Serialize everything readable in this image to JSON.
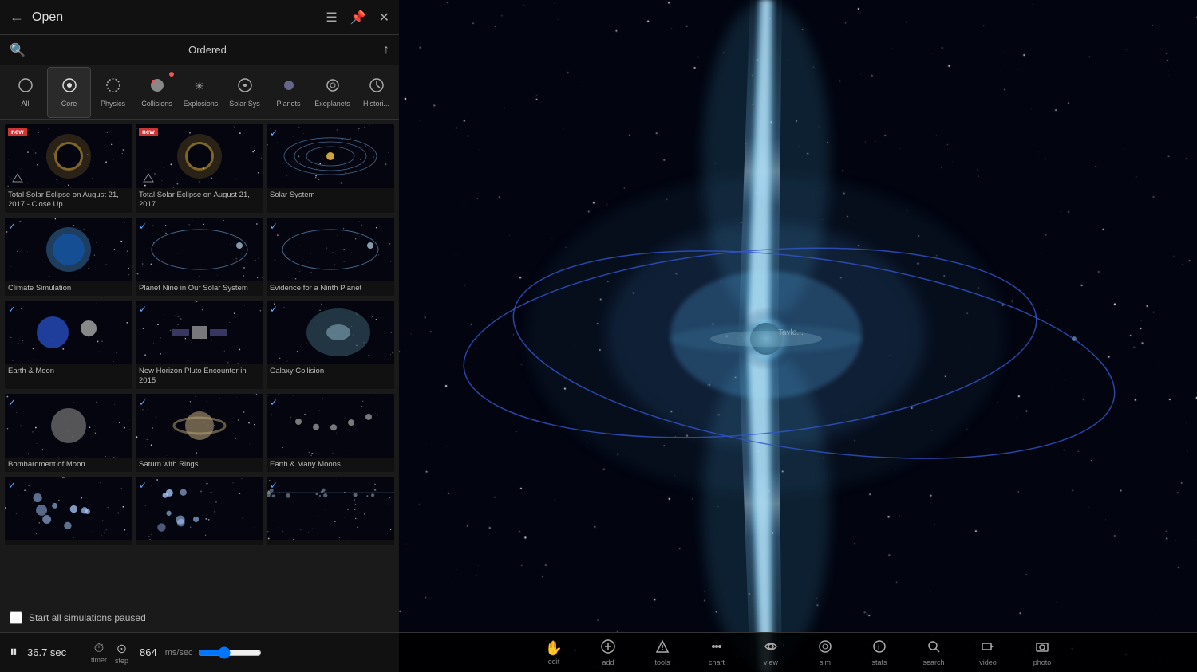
{
  "panel": {
    "title": "Open",
    "back_label": "←",
    "close_label": "✕",
    "pin_label": "📌",
    "list_label": "≡"
  },
  "search": {
    "placeholder": "Search",
    "sort_label": "Ordered",
    "arrow_up": "↑"
  },
  "categories": [
    {
      "id": "all",
      "label": "All",
      "icon": "○",
      "active": false,
      "dot": false
    },
    {
      "id": "core",
      "label": "Core",
      "icon": "⊙",
      "active": true,
      "dot": false
    },
    {
      "id": "physics",
      "label": "Physics",
      "icon": "◌",
      "active": false,
      "dot": false
    },
    {
      "id": "collisions",
      "label": "Collisions",
      "icon": "●",
      "active": false,
      "dot": true
    },
    {
      "id": "explosions",
      "label": "Explosions",
      "icon": "✳",
      "active": false,
      "dot": false
    },
    {
      "id": "solarsys",
      "label": "Solar Sys",
      "icon": "⊙",
      "active": false,
      "dot": false
    },
    {
      "id": "planets",
      "label": "Planets",
      "icon": "⊕",
      "active": false,
      "dot": false
    },
    {
      "id": "exoplanets",
      "label": "Exoplanets",
      "icon": "⊚",
      "active": false,
      "dot": false
    },
    {
      "id": "history",
      "label": "Histori...",
      "icon": "◷",
      "active": false,
      "dot": false
    }
  ],
  "simulations": [
    {
      "row": 0,
      "items": [
        {
          "id": "eclipse-closeup",
          "label": "Total Solar Eclipse on August 21, 2017 - Close Up",
          "badge": "new",
          "check": false,
          "thumb": "eclipse"
        },
        {
          "id": "eclipse-full",
          "label": "Total Solar Eclipse on August 21, 2017",
          "badge": "new",
          "check": false,
          "thumb": "eclipse2"
        },
        {
          "id": "solar-system",
          "label": "Solar System",
          "badge": null,
          "check": true,
          "thumb": "solar-sys"
        }
      ]
    },
    {
      "row": 1,
      "items": [
        {
          "id": "climate",
          "label": "Climate Simulation",
          "badge": null,
          "check": true,
          "thumb": "climate"
        },
        {
          "id": "planet9",
          "label": "Planet Nine in Our Solar System",
          "badge": null,
          "check": true,
          "thumb": "planet9"
        },
        {
          "id": "ninth-planet",
          "label": "Evidence for a Ninth Planet",
          "badge": null,
          "check": true,
          "thumb": "orbit"
        }
      ]
    },
    {
      "row": 2,
      "items": [
        {
          "id": "earth-moon",
          "label": "Earth & Moon",
          "badge": null,
          "check": true,
          "thumb": "earth-moon"
        },
        {
          "id": "new-horizons",
          "label": "New Horizon Pluto Encounter in 2015",
          "badge": null,
          "check": true,
          "thumb": "satellite"
        },
        {
          "id": "galaxy-collision",
          "label": "Galaxy Collision",
          "badge": null,
          "check": true,
          "thumb": "galaxy"
        }
      ]
    },
    {
      "row": 3,
      "items": [
        {
          "id": "bombardment",
          "label": "Bombardment of Moon",
          "badge": null,
          "check": true,
          "thumb": "moon"
        },
        {
          "id": "saturn-rings",
          "label": "Saturn with Rings",
          "badge": null,
          "check": true,
          "thumb": "saturn"
        },
        {
          "id": "many-moons",
          "label": "Earth & Many Moons",
          "badge": null,
          "check": true,
          "thumb": "moons"
        }
      ]
    },
    {
      "row": 4,
      "items": [
        {
          "id": "stars1",
          "label": "",
          "badge": null,
          "check": true,
          "thumb": "stars"
        },
        {
          "id": "stars2",
          "label": "",
          "badge": null,
          "check": true,
          "thumb": "stars2"
        },
        {
          "id": "belt",
          "label": "",
          "badge": null,
          "check": true,
          "thumb": "belt"
        }
      ]
    }
  ],
  "checkbox": {
    "label": "Start all simulations paused",
    "checked": false
  },
  "playback": {
    "playing": false,
    "time": "36.7 sec",
    "timer_label": "timer",
    "step_label": "step",
    "steps": "864",
    "ms_label": "ms/sec"
  },
  "main_toolbar": [
    {
      "id": "edit",
      "icon": "✋",
      "label": "edit"
    },
    {
      "id": "add",
      "icon": "⊕",
      "label": "add"
    },
    {
      "id": "tools",
      "icon": "⬇",
      "label": "tools"
    },
    {
      "id": "chart",
      "icon": "⋯",
      "label": "chart"
    },
    {
      "id": "view",
      "icon": "👁",
      "label": "view"
    },
    {
      "id": "sim",
      "icon": "⊚",
      "label": "sim"
    },
    {
      "id": "stats",
      "icon": "ℹ",
      "label": "stats"
    },
    {
      "id": "search",
      "icon": "🔍",
      "label": "search"
    },
    {
      "id": "video",
      "icon": "▶",
      "label": "video"
    },
    {
      "id": "photo",
      "icon": "📷",
      "label": "photo"
    }
  ],
  "colors": {
    "accent_blue": "#00aaff",
    "panel_bg": "#1a1a1a",
    "panel_dark": "#111111",
    "active_tab": "#2a2a2a",
    "badge_red": "#cc3333"
  }
}
